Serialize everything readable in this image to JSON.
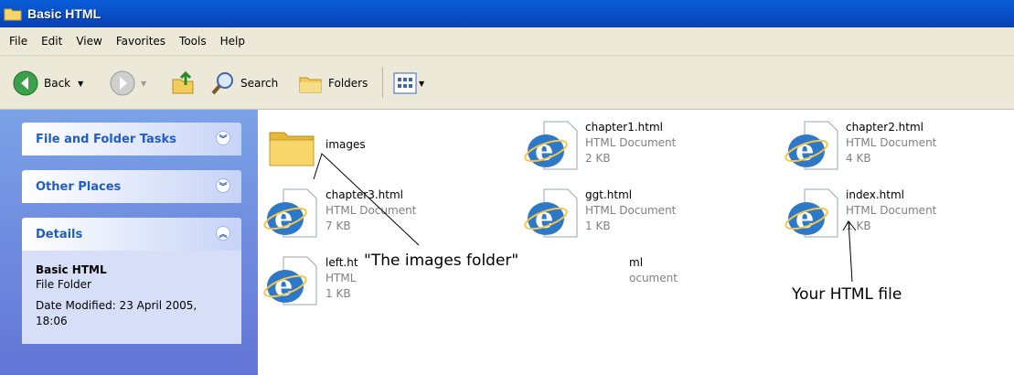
{
  "window": {
    "title": "Basic HTML"
  },
  "menu": [
    "File",
    "Edit",
    "View",
    "Favorites",
    "Tools",
    "Help"
  ],
  "toolbar": {
    "back": "Back",
    "search": "Search",
    "folders": "Folders"
  },
  "sidebar": {
    "panels": {
      "tasks": "File and Folder Tasks",
      "places": "Other Places",
      "details": "Details"
    },
    "details": {
      "name": "Basic HTML",
      "type": "File Folder",
      "modified": "Date Modified: 23 April 2005, 18:06"
    }
  },
  "files": {
    "images": {
      "name": "images"
    },
    "chapter1": {
      "name": "chapter1.html",
      "type": "HTML Document",
      "size": "2 KB"
    },
    "chapter2": {
      "name": "chapter2.html",
      "type": "HTML Document",
      "size": "4 KB"
    },
    "chapter3": {
      "name": "chapter3.html",
      "type": "HTML Document",
      "size": "7 KB"
    },
    "ggt": {
      "name": "ggt.html",
      "type": "HTML Document",
      "size": "1 KB"
    },
    "index": {
      "name": "index.html",
      "type": "HTML Document",
      "size": "1 KB"
    },
    "left": {
      "name": "left.ht",
      "type": "HTML",
      "size": "1 KB"
    },
    "partial": {
      "name": "ml",
      "type": "ocument"
    }
  },
  "annotations": {
    "images_folder": "\"The images folder\"",
    "html_file": "Your HTML file"
  }
}
